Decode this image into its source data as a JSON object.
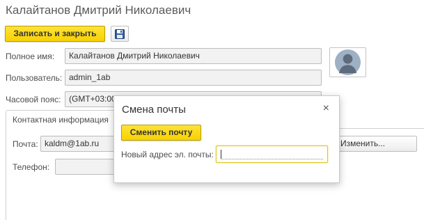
{
  "header": {
    "title": "Калайтанов Дмитрий Николаевич"
  },
  "toolbar": {
    "save_close_label": "Записать и закрыть",
    "save_icon": "floppy-disk-icon"
  },
  "form": {
    "full_name_label": "Полное имя:",
    "full_name_value": "Калайтанов Дмитрий Николаевич",
    "user_label": "Пользователь:",
    "user_value": "admin_1ab",
    "timezone_label": "Часовой пояс:",
    "timezone_value": "(GMT+03:00",
    "avatar_icon": "user-silhouette-icon"
  },
  "tabs": {
    "contact_info_label": "Контактная информация"
  },
  "contact": {
    "email_label": "Почта:",
    "email_value": "kaldm@1ab.ru",
    "change_button_label": "Изменить...",
    "phone_label": "Телефон:",
    "phone_value": ""
  },
  "modal": {
    "title": "Смена почты",
    "close_icon": "close-icon",
    "close_glyph": "×",
    "submit_label": "Сменить почту",
    "new_email_label": "Новый адрес эл. почты:",
    "new_email_value": ""
  },
  "colors": {
    "accent_yellow": "#f7d200",
    "field_bg": "#f2f2f2",
    "border": "#bcbcbc"
  }
}
